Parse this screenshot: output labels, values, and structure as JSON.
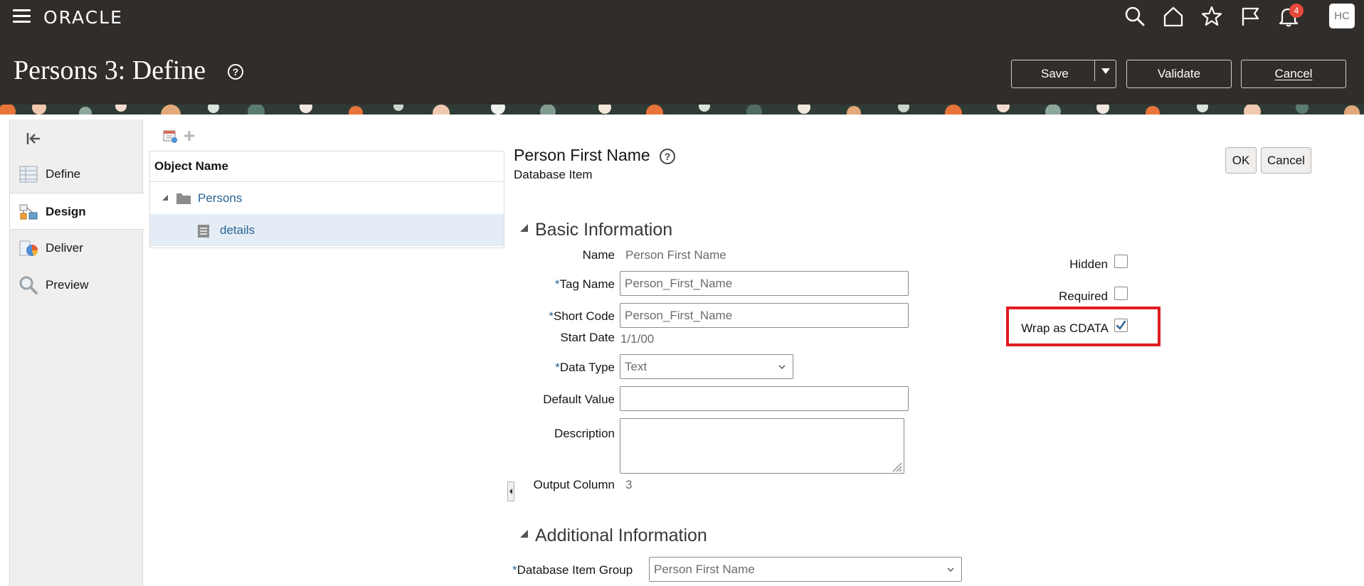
{
  "header": {
    "brand": "ORACLE",
    "page_title": "Persons 3: Define",
    "notification_count": "4",
    "avatar_initials": "HC",
    "save_label": "Save",
    "validate_label": "Validate",
    "cancel_label": "Cancel"
  },
  "leftnav": {
    "items": [
      {
        "label": "Define",
        "icon": "define-icon"
      },
      {
        "label": "Design",
        "icon": "design-icon"
      },
      {
        "label": "Deliver",
        "icon": "deliver-icon"
      },
      {
        "label": "Preview",
        "icon": "preview-icon"
      }
    ],
    "active": "Design"
  },
  "tree": {
    "header": "Object Name",
    "rows": [
      {
        "label": "Persons",
        "icon": "folder-icon",
        "expanded": true
      },
      {
        "label": "details",
        "icon": "document-icon",
        "selected": true
      }
    ]
  },
  "detail": {
    "title": "Person First Name",
    "subtitle": "Database Item",
    "ok_label": "OK",
    "cancel_label": "Cancel",
    "basic_section": "Basic Information",
    "additional_section": "Additional Information",
    "fields": {
      "name_label": "Name",
      "name_value": "Person First Name",
      "tag_name_label": "Tag Name",
      "tag_name_value": "Person_First_Name",
      "short_code_label": "Short Code",
      "short_code_value": "Person_First_Name",
      "start_date_label": "Start Date",
      "start_date_value": "1/1/00",
      "data_type_label": "Data Type",
      "data_type_value": "Text",
      "default_value_label": "Default Value",
      "default_value_value": "",
      "description_label": "Description",
      "description_value": "",
      "output_column_label": "Output Column",
      "output_column_value": "3",
      "db_item_group_label": "Database Item Group",
      "db_item_group_value": "Person First Name"
    },
    "checkboxes": {
      "hidden_label": "Hidden",
      "hidden_checked": false,
      "required_label": "Required",
      "required_checked": false,
      "cdata_label": "Wrap as CDATA",
      "cdata_checked": true
    },
    "required_marker": "*"
  },
  "colors": {
    "header_bg": "#312d2a",
    "link": "#2a6495",
    "highlight": "#e01b23",
    "badge": "#e5493a"
  }
}
